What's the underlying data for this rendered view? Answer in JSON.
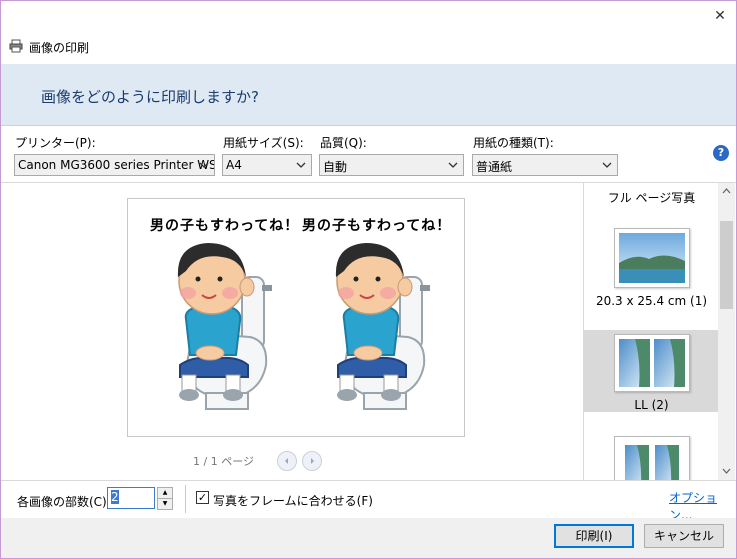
{
  "window": {
    "title": "画像の印刷",
    "close_glyph": "✕"
  },
  "header": {
    "question": "画像をどのように印刷しますか?"
  },
  "settings": {
    "printer": {
      "label": "プリンター(P):",
      "value": "Canon MG3600 series Printer WS"
    },
    "paper_size": {
      "label": "用紙サイズ(S):",
      "value": "A4"
    },
    "quality": {
      "label": "品質(Q):",
      "value": "自動"
    },
    "paper_type": {
      "label": "用紙の種類(T):",
      "value": "普通紙"
    },
    "help_glyph": "?"
  },
  "preview": {
    "captions": [
      "男の子もすわってね！",
      "男の子もすわってね！"
    ],
    "page_counter": "1 / 1 ページ"
  },
  "layouts": {
    "heading": "フル ページ写真",
    "items": [
      {
        "label": "20.3 x 25.4 cm (1)",
        "selected": false
      },
      {
        "label": "LL (2)",
        "selected": true
      },
      {
        "label": "",
        "selected": false
      }
    ]
  },
  "bottom": {
    "copies_label": "各画像の部数(C):",
    "copies_value": "2",
    "fit_label": "写真をフレームに合わせる(F)",
    "fit_checked": true,
    "options_link": "オプション..."
  },
  "buttons": {
    "print": "印刷(I)",
    "cancel": "キャンセル"
  },
  "colors": {
    "header_band": "#dfe9f4",
    "selection": "#d9d9d9",
    "link": "#0066cc",
    "accent": "#0078d7"
  }
}
